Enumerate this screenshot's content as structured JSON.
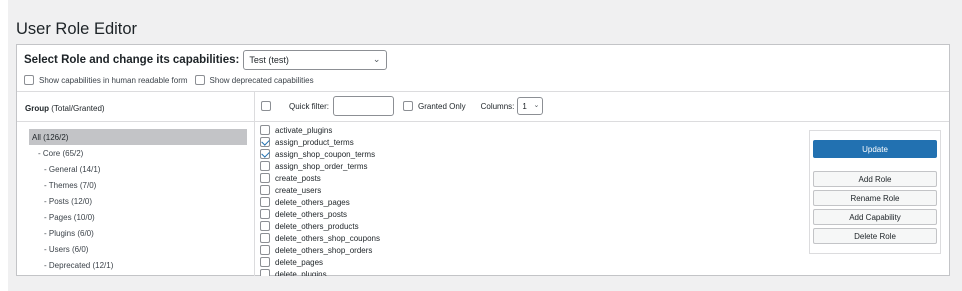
{
  "page": {
    "title": "User Role Editor"
  },
  "role_select": {
    "label": "Select Role and change its capabilities:",
    "value": "Test (test)"
  },
  "options": {
    "human_readable": {
      "label": "Show capabilities in human readable form",
      "checked": false
    },
    "deprecated": {
      "label": "Show deprecated capabilities",
      "checked": false
    }
  },
  "groups": {
    "header_bold": "Group",
    "header_rest": " (Total/Granted)",
    "items": [
      {
        "label": "All (126/2)",
        "indent": 0,
        "selected": true
      },
      {
        "label": "- Core (65/2)",
        "indent": 1,
        "selected": false
      },
      {
        "label": "- General (14/1)",
        "indent": 2,
        "selected": false
      },
      {
        "label": "- Themes (7/0)",
        "indent": 2,
        "selected": false
      },
      {
        "label": "- Posts (12/0)",
        "indent": 2,
        "selected": false
      },
      {
        "label": "- Pages (10/0)",
        "indent": 2,
        "selected": false
      },
      {
        "label": "- Plugins (6/0)",
        "indent": 2,
        "selected": false
      },
      {
        "label": "- Users (6/0)",
        "indent": 2,
        "selected": false
      },
      {
        "label": "- Deprecated (12/1)",
        "indent": 2,
        "selected": false
      }
    ]
  },
  "filter": {
    "quick_filter_label": "Quick filter:",
    "quick_filter_value": "",
    "granted_only_label": "Granted Only",
    "granted_only_checked": false,
    "columns_label": "Columns:",
    "columns_value": "1"
  },
  "capabilities": [
    {
      "name": "activate_plugins",
      "checked": false
    },
    {
      "name": "assign_product_terms",
      "checked": true
    },
    {
      "name": "assign_shop_coupon_terms",
      "checked": true
    },
    {
      "name": "assign_shop_order_terms",
      "checked": false
    },
    {
      "name": "create_posts",
      "checked": false
    },
    {
      "name": "create_users",
      "checked": false
    },
    {
      "name": "delete_others_pages",
      "checked": false
    },
    {
      "name": "delete_others_posts",
      "checked": false
    },
    {
      "name": "delete_others_products",
      "checked": false
    },
    {
      "name": "delete_others_shop_coupons",
      "checked": false
    },
    {
      "name": "delete_others_shop_orders",
      "checked": false
    },
    {
      "name": "delete_pages",
      "checked": false
    },
    {
      "name": "delete_plugins",
      "checked": false
    }
  ],
  "actions": {
    "update": "Update",
    "add_role": "Add Role",
    "rename_role": "Rename Role",
    "add_capability": "Add Capability",
    "delete_role": "Delete Role"
  },
  "colors": {
    "primary": "#2271b1",
    "selected_group_bg": "#c3c4c7",
    "page_bg": "#f0f0f1"
  }
}
